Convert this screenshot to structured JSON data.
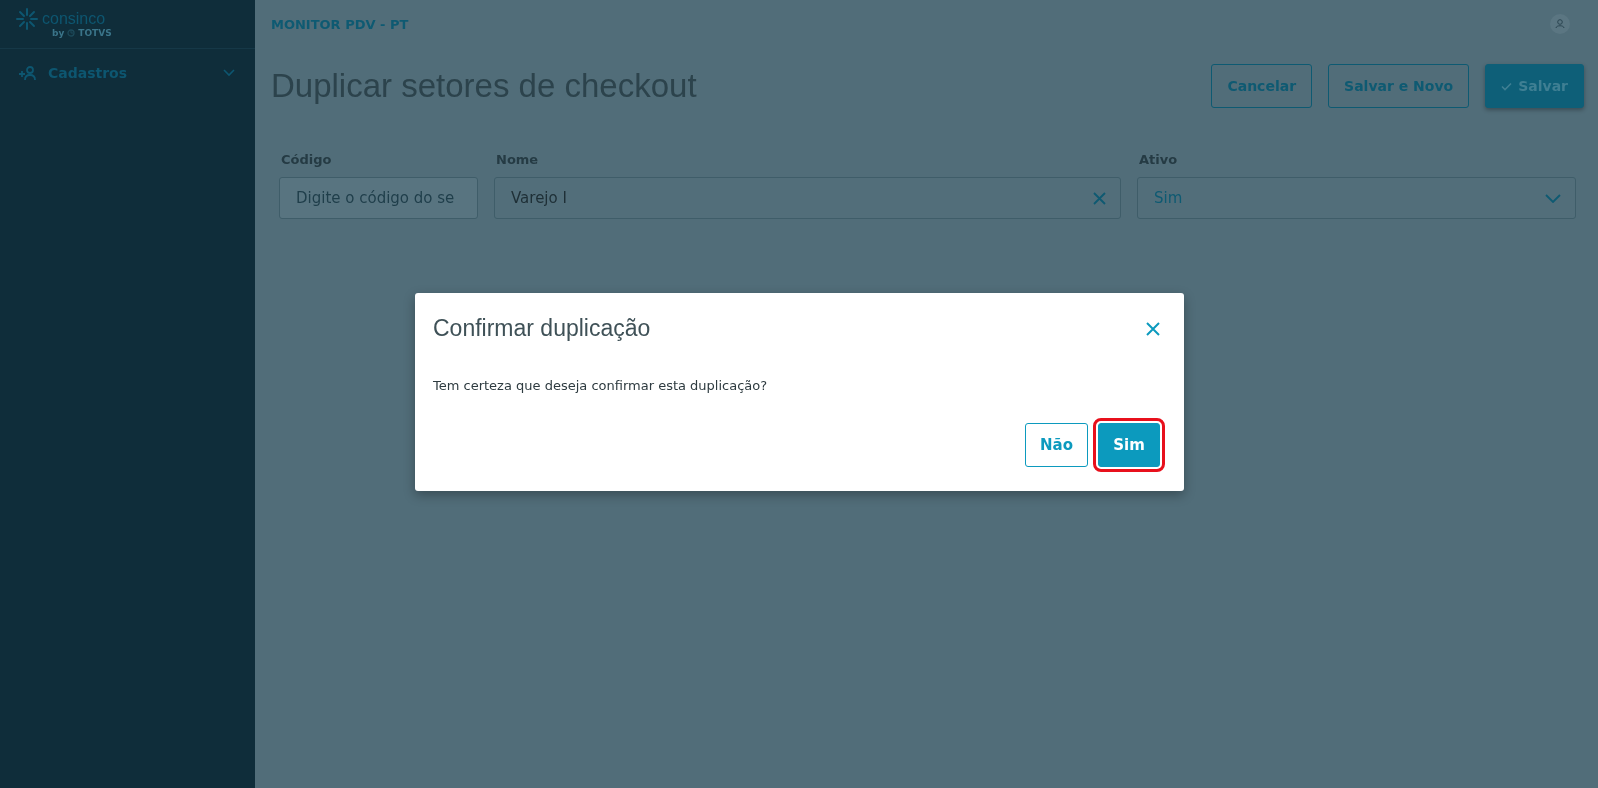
{
  "sidebar": {
    "logo": {
      "name": "consinco",
      "byline": "by",
      "brand": "TOTVS"
    },
    "menu": [
      {
        "label": "Cadastros",
        "expanded": false
      }
    ]
  },
  "header": {
    "app_title": "MONITOR PDV - PT"
  },
  "page": {
    "title": "Duplicar setores de checkout",
    "actions": [
      {
        "label": "Cancelar",
        "kind": "secondary"
      },
      {
        "label": "Salvar e Novo",
        "kind": "secondary"
      },
      {
        "label": "Salvar",
        "kind": "primary"
      }
    ]
  },
  "form": {
    "fields": [
      {
        "label": "Código",
        "kind": "text",
        "placeholder": "Digite o código do se",
        "disabled": true
      },
      {
        "label": "Nome",
        "kind": "text",
        "value": "Varejo I",
        "clearable": true
      },
      {
        "label": "Ativo",
        "kind": "select",
        "value": "Sim"
      }
    ]
  },
  "dialog": {
    "title": "Confirmar duplicação",
    "message": "Tem certeza que deseja confirmar esta duplicação?",
    "buttons": [
      {
        "label": "Não",
        "kind": "secondary",
        "highlighted": false
      },
      {
        "label": "Sim",
        "kind": "primary",
        "highlighted": true
      }
    ]
  }
}
